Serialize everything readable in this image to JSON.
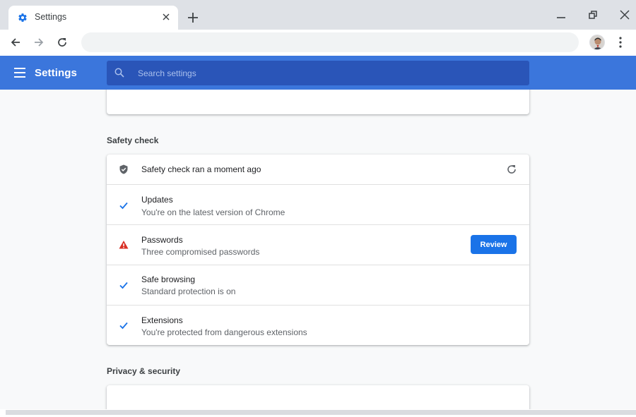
{
  "browser": {
    "tab": {
      "title": "Settings",
      "favicon": "settings-gear-icon"
    },
    "new_tab_icon": "plus-icon",
    "window_controls": [
      "minimize-icon",
      "restore-icon",
      "close-icon"
    ],
    "omnibox": {
      "value": "",
      "placeholder": ""
    },
    "nav_icons": [
      "back-arrow-icon",
      "forward-arrow-icon",
      "reload-icon"
    ],
    "profile_icon": "avatar",
    "menu_icon": "more-vert-icon"
  },
  "header": {
    "title": "Settings",
    "search_placeholder": "Search settings"
  },
  "safety_check": {
    "heading": "Safety check",
    "status": "Safety check ran a moment ago",
    "items": [
      {
        "title": "Updates",
        "subtitle": "You're on the latest version of Chrome",
        "status": "ok"
      },
      {
        "title": "Passwords",
        "subtitle": "Three compromised passwords",
        "status": "warning",
        "action": "Review"
      },
      {
        "title": "Safe browsing",
        "subtitle": "Standard protection is on",
        "status": "ok"
      },
      {
        "title": "Extensions",
        "subtitle": "You're protected from dangerous extensions",
        "status": "ok"
      }
    ]
  },
  "privacy": {
    "heading": "Privacy & security"
  },
  "colors": {
    "header": "#3b76dc",
    "accent": "#1a73e8",
    "warning": "#d93025",
    "check": "#1a73e8"
  }
}
